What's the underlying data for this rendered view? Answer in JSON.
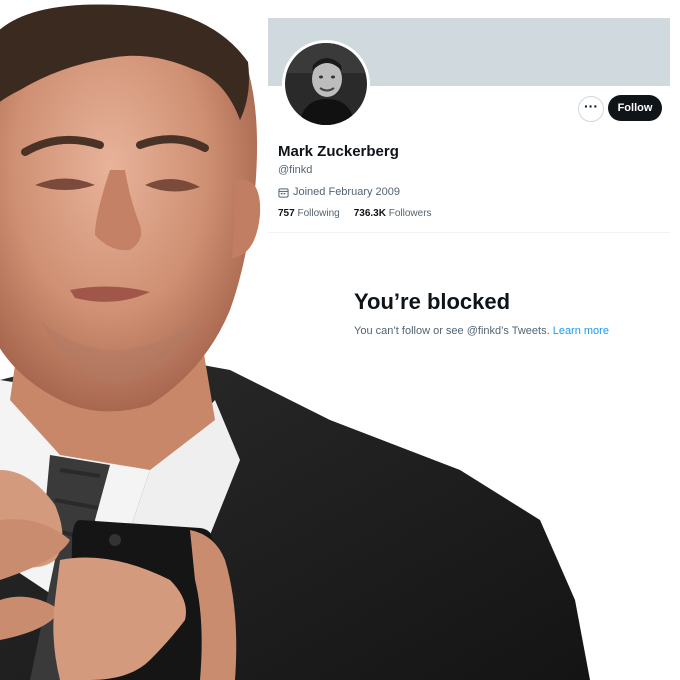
{
  "profile": {
    "display_name": "Mark Zuckerberg",
    "handle": "@finkd",
    "joined": "Joined February 2009",
    "following_count": "757",
    "following_label": "Following",
    "followers_count": "736.3K",
    "followers_label": "Followers",
    "follow_button": "Follow",
    "more_button": "···",
    "icons": {
      "more": "more-horizontal-icon",
      "calendar": "calendar-icon"
    }
  },
  "blocked": {
    "title": "You’re blocked",
    "description": "You can’t follow or see @finkd’s Tweets.",
    "learn_more": "Learn more"
  },
  "colors": {
    "banner": "#cfd9de",
    "follow_button_bg": "#0f1419",
    "link": "#1d9bf0",
    "secondary_text": "#536471"
  }
}
